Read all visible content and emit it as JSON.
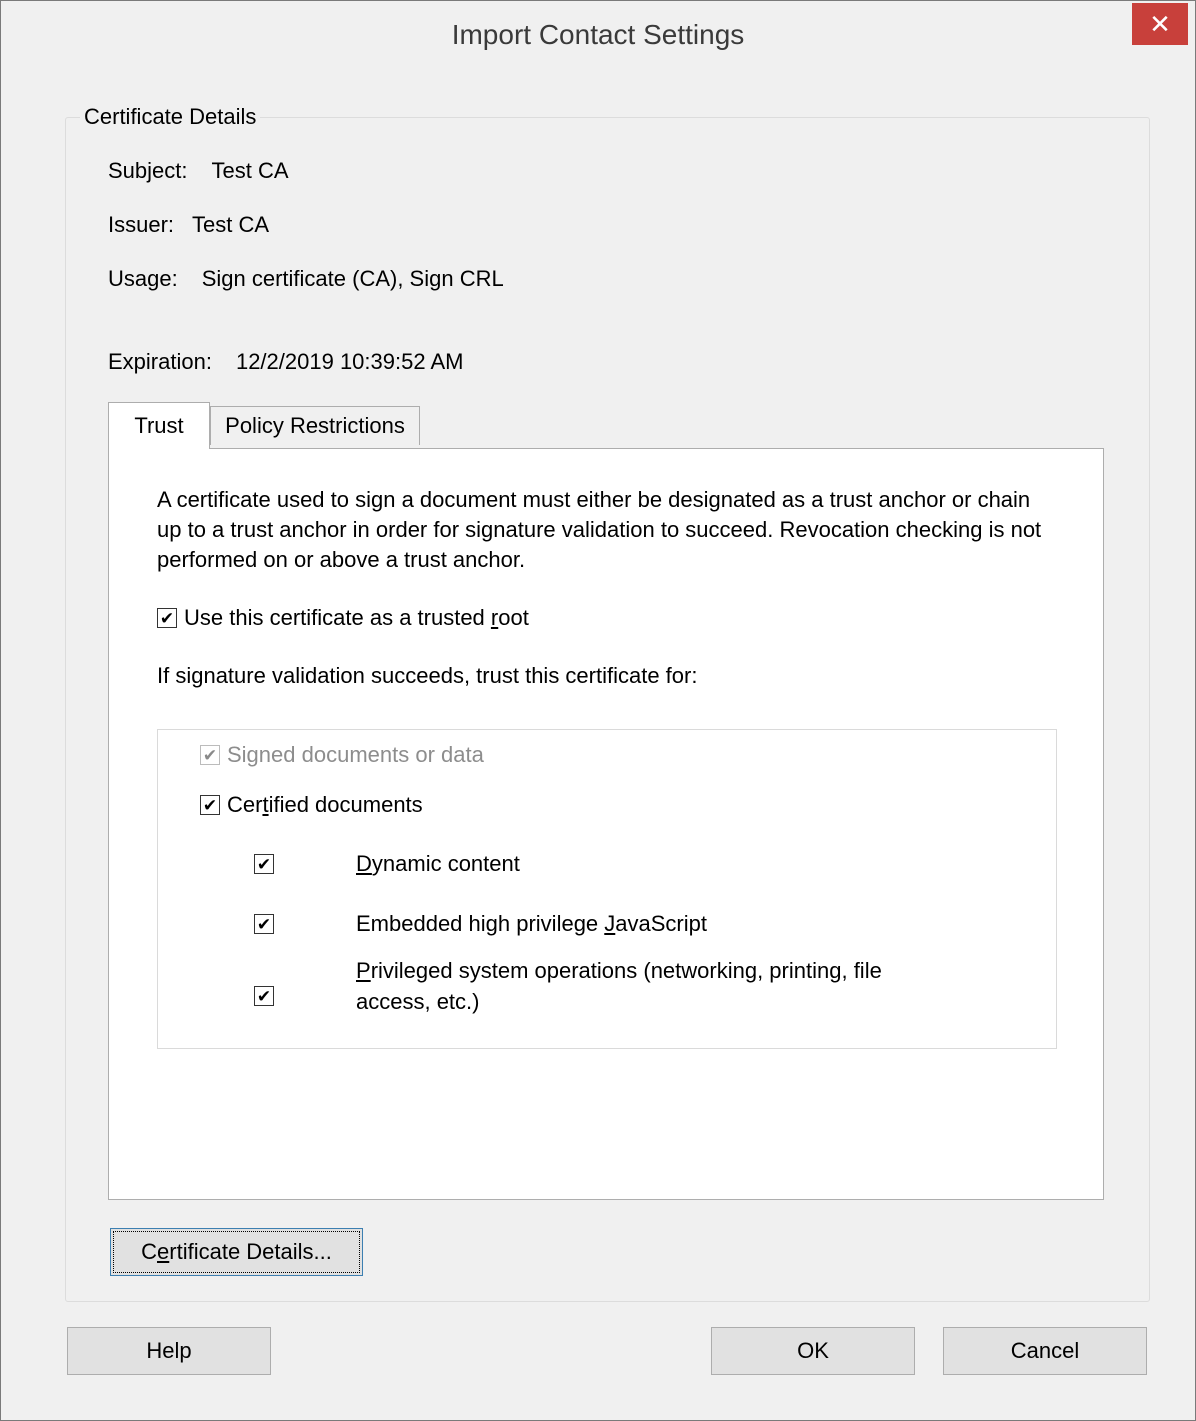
{
  "window": {
    "title": "Import Contact Settings",
    "close_glyph": "✕"
  },
  "group": {
    "legend": "Certificate Details"
  },
  "fields": {
    "subject": {
      "label": "Subject:",
      "value": "Test CA"
    },
    "issuer": {
      "label": "Issuer:",
      "value": "Test CA"
    },
    "usage": {
      "label": "Usage:",
      "value": "Sign certificate (CA), Sign CRL"
    },
    "expiration": {
      "label": "Expiration:",
      "value": "12/2/2019 10:39:52 AM"
    }
  },
  "tabs": [
    {
      "label": "Trust",
      "active": true
    },
    {
      "label": "Policy Restrictions",
      "active": false
    }
  ],
  "trust": {
    "description": "A certificate used to sign a document must either be designated as a trust anchor or chain up to a trust anchor in order for signature validation to succeed.  Revocation checking is not performed on or above a trust anchor.",
    "trusted_root": {
      "pre": "Use this certificate as a trusted ",
      "mnemonic": "r",
      "post": "oot",
      "checked": true
    },
    "trust_for_label": "If signature validation succeeds, trust this certificate for:",
    "options": {
      "signed": {
        "label": "Signed documents or data",
        "checked": true,
        "disabled": true
      },
      "certified": {
        "pre": "Cer",
        "mnemonic": "t",
        "post": "ified documents",
        "checked": true
      },
      "dynamic": {
        "pre": "",
        "mnemonic": "D",
        "post": "ynamic content",
        "checked": true
      },
      "javascript": {
        "pre": "Embedded high privilege ",
        "mnemonic": "J",
        "post": "avaScript",
        "checked": true
      },
      "privileged": {
        "pre": "",
        "mnemonic": "P",
        "post": "rivileged system operations (networking, printing, file access, etc.)",
        "checked": true
      }
    }
  },
  "buttons": {
    "certificate_details": {
      "pre": "C",
      "mnemonic": "e",
      "post": "rtificate Details..."
    },
    "help": "Help",
    "ok": "OK",
    "cancel": "Cancel"
  },
  "check_glyph": "✔"
}
